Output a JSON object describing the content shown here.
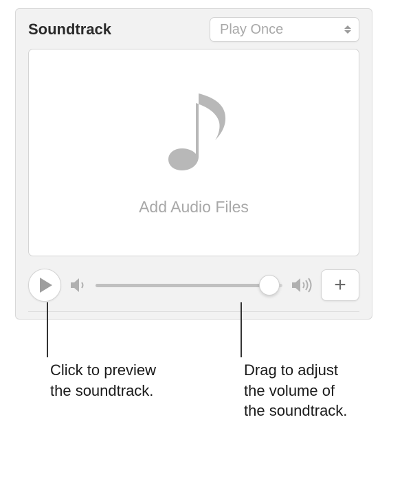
{
  "panel": {
    "title": "Soundtrack",
    "playback_mode": "Play Once",
    "dropzone_label": "Add Audio Files",
    "volume_percent": 93
  },
  "callouts": {
    "preview": "Click to preview the soundtrack.",
    "volume": "Drag to adjust the volume of the soundtrack."
  }
}
